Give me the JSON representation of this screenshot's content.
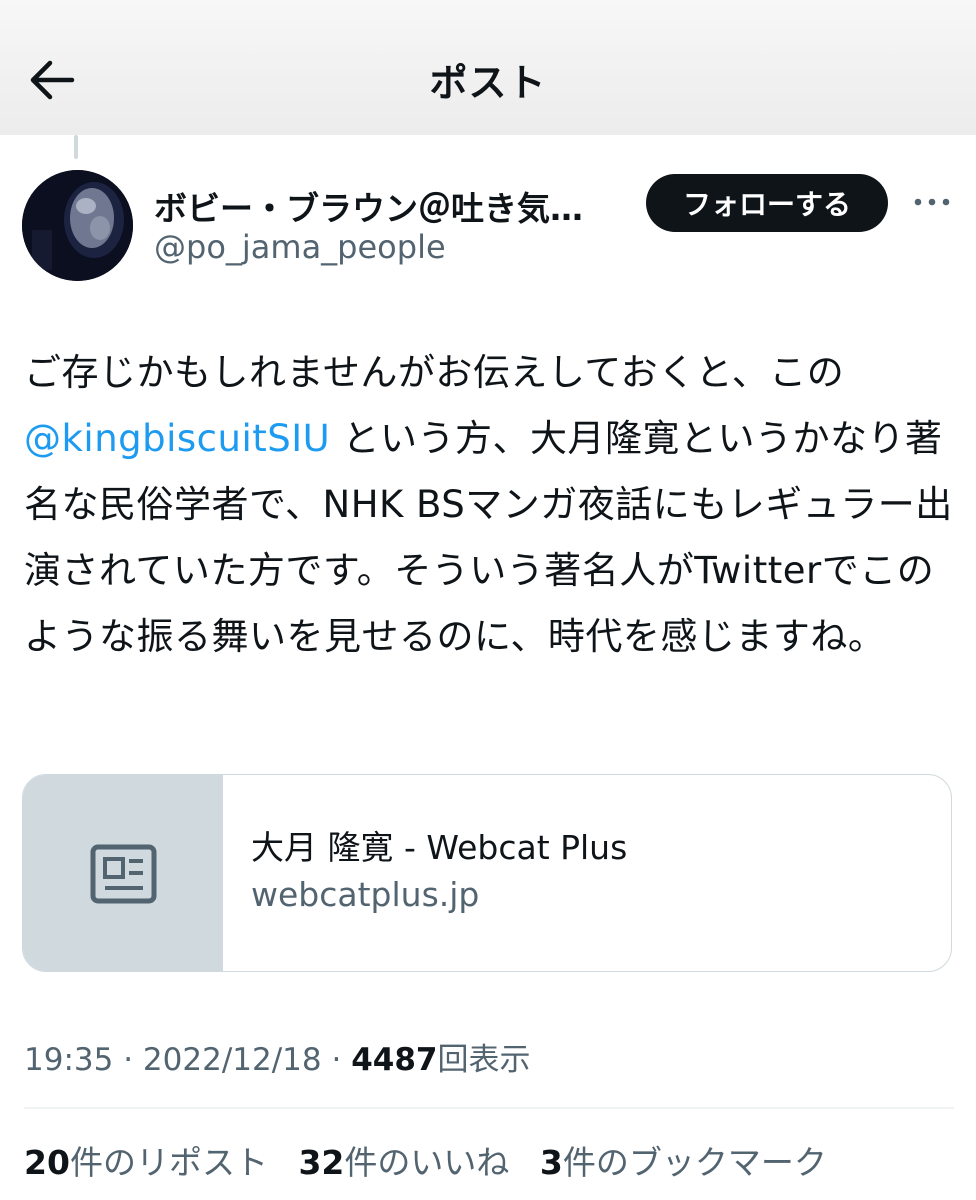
{
  "header": {
    "title": "ポスト"
  },
  "post": {
    "display_name": "ボビー・ブラウン＠吐き気…",
    "handle": "@po_jama_people",
    "follow_label": "フォローする",
    "text": {
      "part1": "ご存じかもしれませんがお伝えしておくと、この",
      "mention": "@kingbiscuitSIU",
      "part2": " という方、大月隆寛というかなり著名な民俗学者で、NHK BSマンガ夜話にもレギュラー出演されていた方です。そういう著名人がTwitterでこのような振る舞いを見せるのに、時代を感じますね。"
    },
    "link_card": {
      "title": "大月 隆寛 - Webcat Plus",
      "domain": "webcatplus.jp"
    },
    "time": "19:35",
    "date": "2022/12/18",
    "views": "4487",
    "views_label": "回表示",
    "separator": "·",
    "stats": [
      {
        "count": "20",
        "label": "件のリポスト"
      },
      {
        "count": "32",
        "label": "件のいいね"
      },
      {
        "count": "3",
        "label": "件のブックマーク"
      }
    ]
  },
  "colors": {
    "link": "#1d9bf0",
    "muted": "#536471",
    "text": "#0f1419",
    "button": "#0f1419"
  },
  "icons": [
    "back-arrow-icon",
    "more-icon",
    "article-icon"
  ]
}
